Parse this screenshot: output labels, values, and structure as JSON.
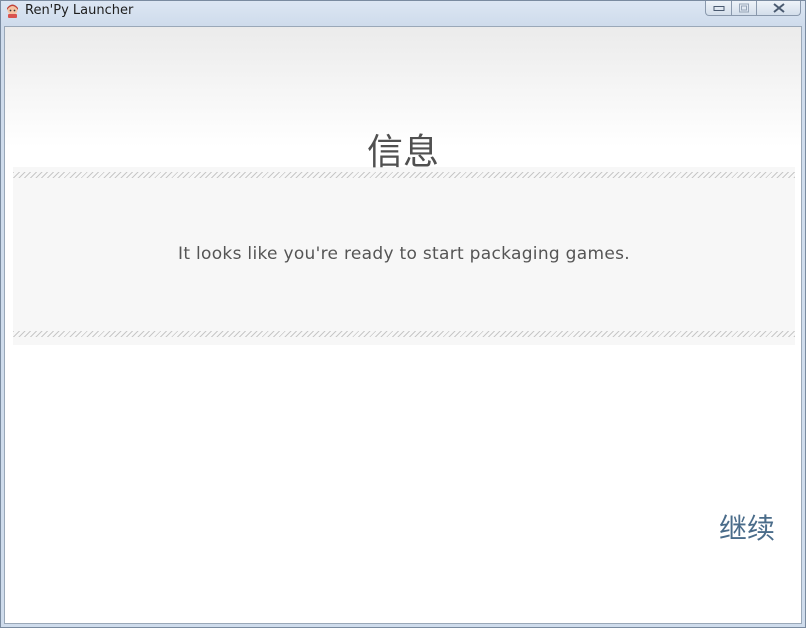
{
  "window": {
    "title": "Ren'Py Launcher",
    "icon": "renpy-app-icon",
    "caption_buttons": [
      "minimize-icon",
      "maximize-icon",
      "close-icon"
    ]
  },
  "dialog": {
    "title": "信息",
    "message": "It looks like you're ready to start packaging games.",
    "continue_label": "继续"
  },
  "colors": {
    "title_text": "#505050",
    "message_text": "#555555",
    "continue_text": "#4a6c8a",
    "band_background": "#f7f7f7"
  }
}
